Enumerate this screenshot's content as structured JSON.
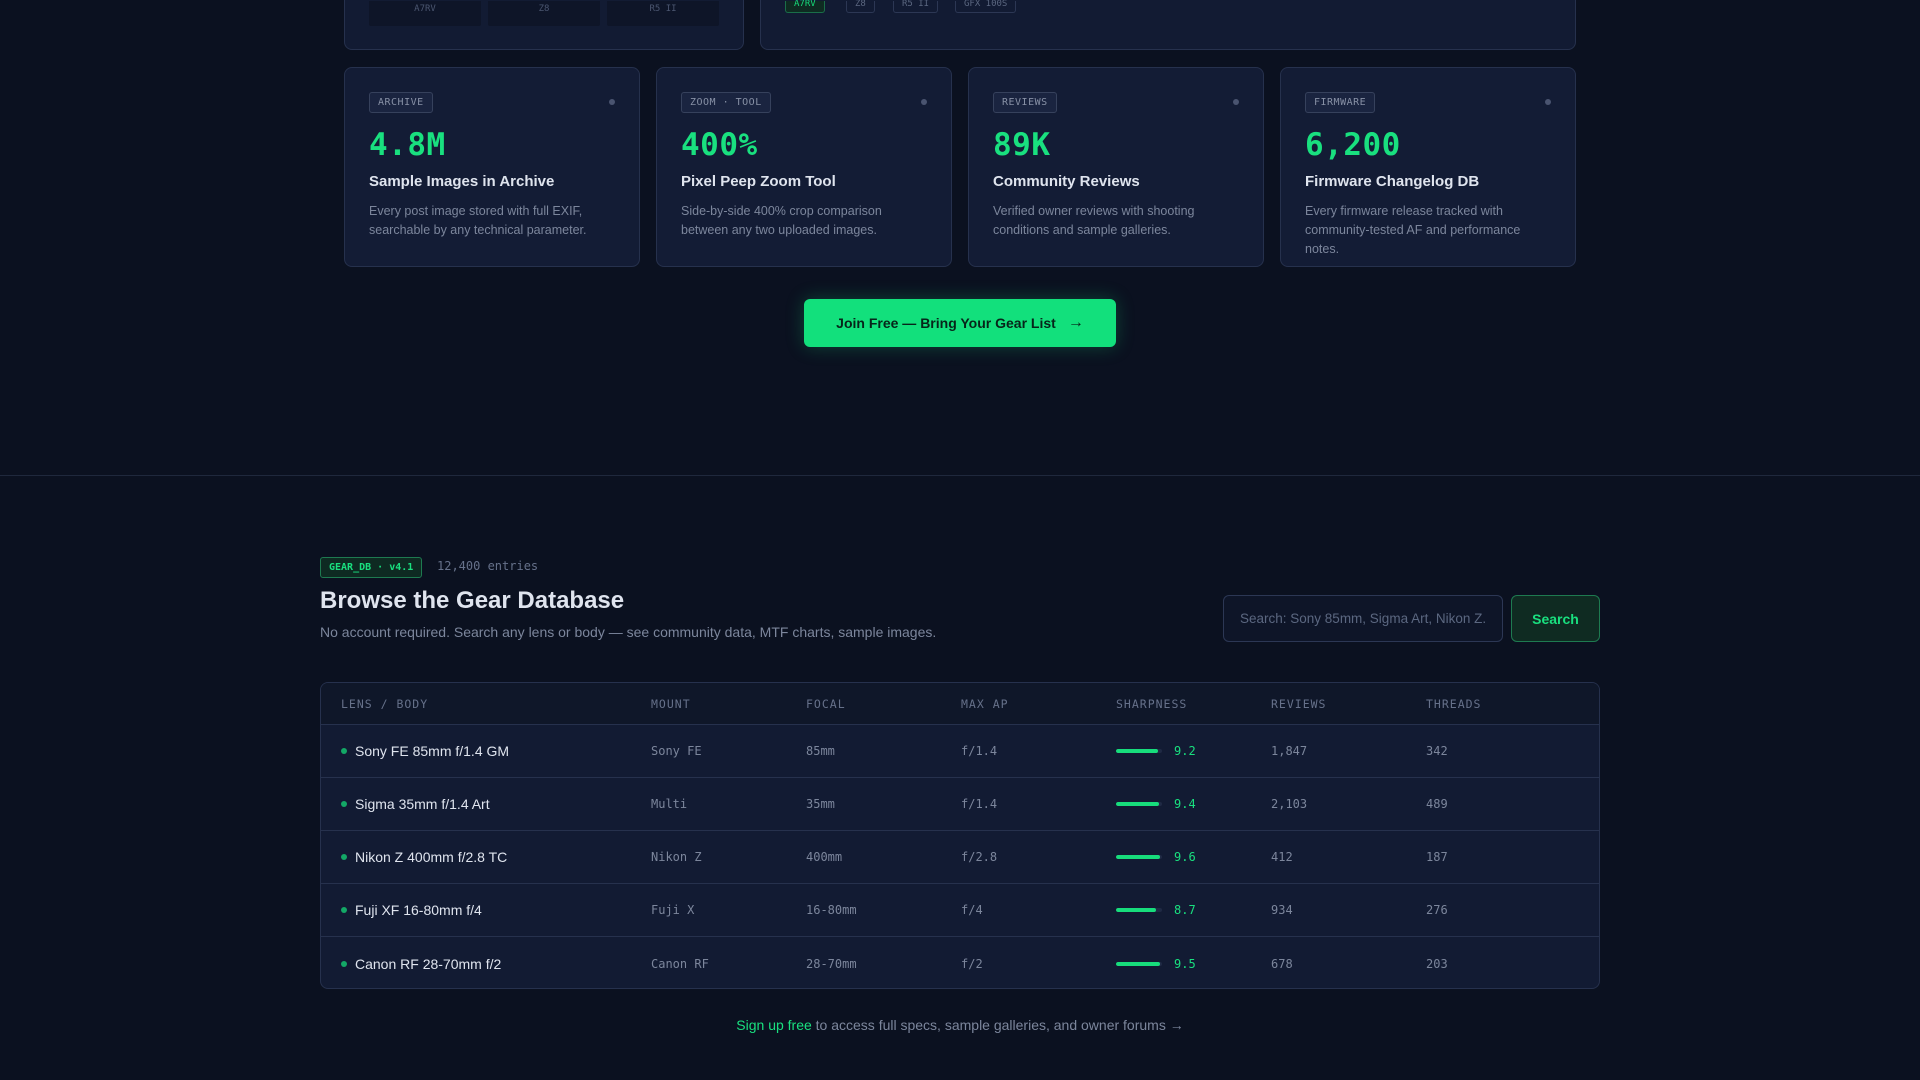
{
  "top": {
    "thumbs": [
      "A7RV",
      "Z8",
      "R5 II"
    ],
    "chips": [
      "A7RV",
      "Z8",
      "R5 II",
      "GFX 100S"
    ]
  },
  "stats": [
    {
      "tag": "ARCHIVE",
      "value": "4.8M",
      "title": "Sample Images in Archive",
      "desc": "Every post image stored with full EXIF, searchable by any technical parameter."
    },
    {
      "tag": "ZOOM · TOOL",
      "value": "400%",
      "title": "Pixel Peep Zoom Tool",
      "desc": "Side-by-side 400% crop comparison between any two uploaded images."
    },
    {
      "tag": "REVIEWS",
      "value": "89K",
      "title": "Community Reviews",
      "desc": "Verified owner reviews with shooting conditions and sample galleries."
    },
    {
      "tag": "FIRMWARE",
      "value": "6,200",
      "title": "Firmware Changelog DB",
      "desc": "Every firmware release tracked with community-tested AF and performance notes."
    }
  ],
  "cta": {
    "label": "Join Free — Bring Your Gear List",
    "arrow": "→"
  },
  "db": {
    "badge": "GEAR_DB · v4.1",
    "entries": "12,400 entries",
    "title": "Browse the Gear Database",
    "subtitle": "No account required. Search any lens or body — see community data, MTF charts, sample images.",
    "search_placeholder": "Search: Sony 85mm, Sigma Art, Nikon Z...",
    "search_button": "Search"
  },
  "table": {
    "headers": [
      "LENS / BODY",
      "MOUNT",
      "FOCAL",
      "MAX AP",
      "SHARPNESS",
      "REVIEWS",
      "THREADS"
    ],
    "rows": [
      {
        "name": "Sony FE 85mm f/1.4 GM",
        "mount": "Sony FE",
        "focal": "85mm",
        "ap": "f/1.4",
        "sharpness": "9.2",
        "reviews": "1,847",
        "threads": "342"
      },
      {
        "name": "Sigma 35mm f/1.4 Art",
        "mount": "Multi",
        "focal": "35mm",
        "ap": "f/1.4",
        "sharpness": "9.4",
        "reviews": "2,103",
        "threads": "489"
      },
      {
        "name": "Nikon Z 400mm f/2.8 TC",
        "mount": "Nikon Z",
        "focal": "400mm",
        "ap": "f/2.8",
        "sharpness": "9.6",
        "reviews": "412",
        "threads": "187"
      },
      {
        "name": "Fuji XF 16-80mm f/4",
        "mount": "Fuji X",
        "focal": "16-80mm",
        "ap": "f/4",
        "sharpness": "8.7",
        "reviews": "934",
        "threads": "276"
      },
      {
        "name": "Canon RF 28-70mm f/2",
        "mount": "Canon RF",
        "focal": "28-70mm",
        "ap": "f/2",
        "sharpness": "9.5",
        "reviews": "678",
        "threads": "203"
      }
    ]
  },
  "footer": {
    "link": "Sign up free",
    "text": " to access full specs, sample galleries, and owner forums →"
  },
  "colors": {
    "accent": "#19e07f",
    "background": "#0b1120",
    "card": "#131c35"
  }
}
